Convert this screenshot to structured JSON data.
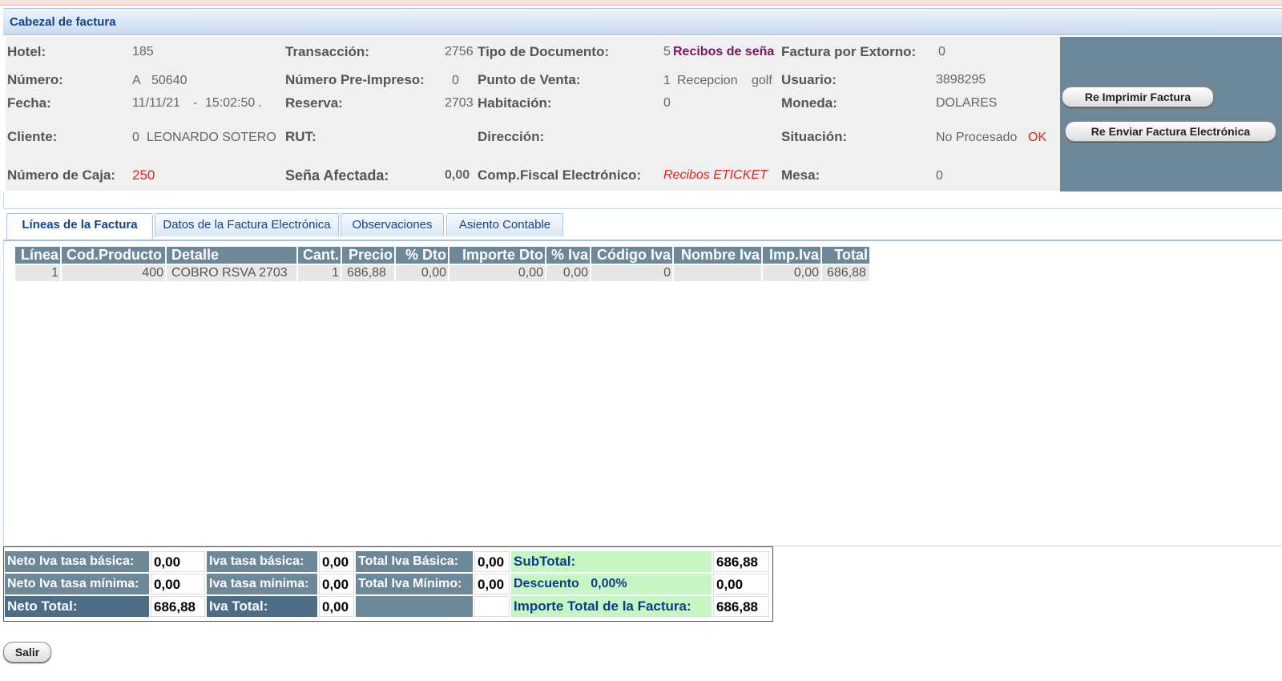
{
  "panel_title": "Cabezal de factura",
  "header": {
    "hotel": {
      "label": "Hotel:",
      "value": "185"
    },
    "numero": {
      "label": "Número:",
      "serie": "A",
      "value": "50640"
    },
    "fecha": {
      "label": "Fecha:",
      "date": "11/11/21",
      "dash": "-",
      "time": "15:02:50",
      "dot": "."
    },
    "cliente": {
      "label": "Cliente:",
      "code": "0",
      "name": "LEONARDO SOTERO"
    },
    "caja": {
      "label": "Número de Caja:",
      "value": "250"
    },
    "transaccion": {
      "label": "Transacción:",
      "value": "2756"
    },
    "preimpreso": {
      "label": "Número Pre-Impreso:",
      "value": "0"
    },
    "reserva": {
      "label": "Reserva:",
      "value": "2703"
    },
    "rut": {
      "label": "RUT:",
      "value": ""
    },
    "sena": {
      "label": "Seña Afectada:",
      "value": "0,00"
    },
    "tipo_doc": {
      "label": "Tipo de Documento:",
      "code": "5",
      "name": "Recibos de seña"
    },
    "punto_venta": {
      "label": "Punto de Venta:",
      "code": "1",
      "name": "Recepcion",
      "extra": "golf"
    },
    "habitacion": {
      "label": "Habitación:",
      "value": "0"
    },
    "direccion": {
      "label": "Dirección:",
      "value": ""
    },
    "comp_fiscal": {
      "label": "Comp.Fiscal Electrónico:",
      "value": "Recibos ETICKET"
    },
    "extorno": {
      "label": "Factura por Extorno:",
      "value": "0"
    },
    "usuario": {
      "label": "Usuario:",
      "value": "3898295"
    },
    "moneda": {
      "label": "Moneda:",
      "value": "DOLARES"
    },
    "situacion": {
      "label": "Situación:",
      "value": "No Procesado",
      "status": "OK"
    },
    "mesa": {
      "label": "Mesa:",
      "value": "0"
    }
  },
  "buttons": {
    "reprint": "Re Imprimir Factura",
    "resend": "Re Enviar Factura Electrónica",
    "exit": "Salir"
  },
  "tabs": [
    {
      "label": "Líneas de la Factura",
      "active": true
    },
    {
      "label": "Datos de la Factura Electrónica",
      "active": false
    },
    {
      "label": "Observaciones",
      "active": false
    },
    {
      "label": "Asiento Contable",
      "active": false
    }
  ],
  "grid": {
    "columns": [
      "Línea",
      "Cod.Producto",
      "Detalle",
      "Cant.",
      "Precio",
      "% Dto",
      "Importe Dto",
      "% Iva",
      "Código Iva",
      "Nombre Iva",
      "Imp.Iva",
      "Total"
    ],
    "rows": [
      [
        "1",
        "400",
        "COBRO RSVA 2703",
        "1",
        "686,88",
        "0,00",
        "0,00",
        "0,00",
        "0",
        "",
        "0,00",
        "686,88"
      ]
    ]
  },
  "totals": {
    "neto_basica": {
      "label": "Neto Iva tasa básica:",
      "value": "0,00"
    },
    "neto_minima": {
      "label": "Neto Iva tasa mínima:",
      "value": "0,00"
    },
    "neto_total": {
      "label": "Neto Total:",
      "value": "686,88"
    },
    "iva_basica": {
      "label": "Iva tasa básica:",
      "value": "0,00"
    },
    "iva_minima": {
      "label": "Iva tasa mínima:",
      "value": "0,00"
    },
    "iva_total": {
      "label": "Iva Total:",
      "value": "0,00"
    },
    "total_iva_basica": {
      "label": "Total Iva Básica:",
      "value": "0,00"
    },
    "total_iva_minimo": {
      "label": "Total Iva Mínimo:",
      "value": "0,00"
    },
    "subtotal": {
      "label": "SubTotal:",
      "value": "686,88"
    },
    "descuento": {
      "label": "Descuento",
      "pct": "0,00%",
      "value": "0,00"
    },
    "importe_total": {
      "label": "Importe Total de la Factura:",
      "value": "686,88"
    }
  },
  "colors": {
    "header_bg": "#6d8898",
    "accent_blue": "#15428b",
    "red": "#e8201a",
    "green_cell": "#c7f6c5"
  }
}
